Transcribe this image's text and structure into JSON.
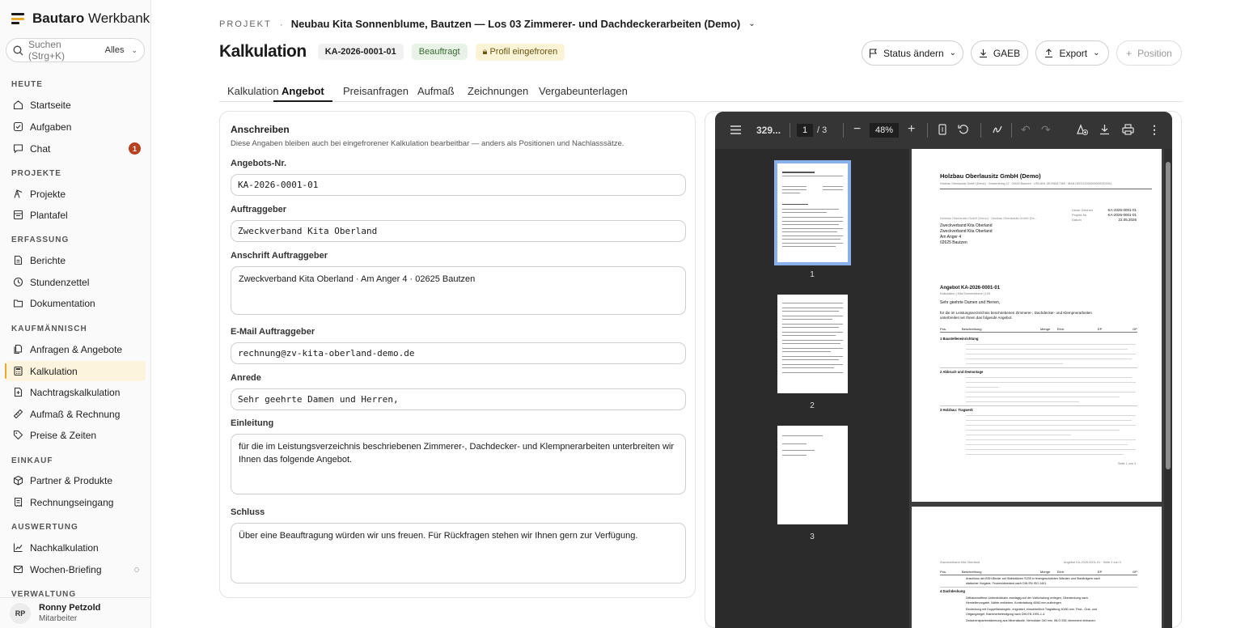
{
  "app": {
    "brand_bold": "Bautaro",
    "brand_light": " Werkbank"
  },
  "search": {
    "placeholder": "Suchen (Strg+K)",
    "scope": "Alles"
  },
  "sidebar": {
    "sections": [
      {
        "title": "HEUTE",
        "items": [
          {
            "label": "Startseite",
            "icon": "home-icon"
          },
          {
            "label": "Aufgaben",
            "icon": "checkbox-icon"
          },
          {
            "label": "Chat",
            "icon": "chat-icon",
            "badge": "1"
          }
        ]
      },
      {
        "title": "PROJEKTE",
        "items": [
          {
            "label": "Projekte",
            "icon": "crane-icon"
          },
          {
            "label": "Plantafel",
            "icon": "board-icon"
          }
        ]
      },
      {
        "title": "ERFASSUNG",
        "items": [
          {
            "label": "Berichte",
            "icon": "file-icon"
          },
          {
            "label": "Stundenzettel",
            "icon": "clock-icon"
          },
          {
            "label": "Dokumentation",
            "icon": "folder-icon"
          }
        ]
      },
      {
        "title": "KAUFMÄNNISCH",
        "items": [
          {
            "label": "Anfragen & Angebote",
            "icon": "file-copy-icon"
          },
          {
            "label": "Kalkulation",
            "icon": "calculator-icon",
            "active": true
          },
          {
            "label": "Nachtragskalkulation",
            "icon": "file-plus-icon"
          },
          {
            "label": "Aufmaß & Rechnung",
            "icon": "ruler-icon"
          },
          {
            "label": "Preise & Zeiten",
            "icon": "tag-icon"
          }
        ]
      },
      {
        "title": "EINKAUF",
        "items": [
          {
            "label": "Partner & Produkte",
            "icon": "box-icon"
          },
          {
            "label": "Rechnungseingang",
            "icon": "receipt-icon"
          }
        ]
      },
      {
        "title": "AUSWERTUNG",
        "items": [
          {
            "label": "Nachkalkulation",
            "icon": "chart-icon"
          },
          {
            "label": "Wochen-Briefing",
            "icon": "mail-icon"
          }
        ]
      },
      {
        "title": "VERWALTUNG",
        "items": []
      }
    ]
  },
  "user": {
    "initials": "RP",
    "name": "Ronny Petzold",
    "role": "Mitarbeiter"
  },
  "header": {
    "crumb_label": "PROJEKT",
    "crumb_sep": "·",
    "project": "Neubau Kita Sonnenblume, Bautzen — Los 03 Zimmerer- und Dachdeckerarbeiten (Demo)",
    "title": "Kalkulation",
    "id_badge": "KA-2026-0001-01",
    "status_badge": "Beauftragt",
    "profile_badge": "Profil eingefroren",
    "buttons": {
      "status": "Status ändern",
      "gaeb": "GAEB",
      "export": "Export",
      "position": "Position"
    }
  },
  "tabs": [
    "Kalkulation",
    "Angebot",
    "Preisanfragen",
    "Aufmaß",
    "Zeichnungen",
    "Vergabeunterlagen"
  ],
  "form": {
    "title": "Anschreiben",
    "subtitle": "Diese Angaben bleiben auch bei eingefrorener Kalkulation bearbeitbar — anders als Positionen und Nachlasssätze.",
    "angebot_nr": {
      "label": "Angebots-Nr.",
      "value": "KA-2026-0001-01"
    },
    "auftraggeber": {
      "label": "Auftraggeber",
      "value": "Zweckverband Kita Oberland"
    },
    "anschrift": {
      "label": "Anschrift Auftraggeber",
      "value": "Zweckverband Kita Oberland · Am Anger 4 · 02625 Bautzen"
    },
    "email": {
      "label": "E-Mail Auftraggeber",
      "value": "rechnung@zv-kita-oberland-demo.de"
    },
    "anrede": {
      "label": "Anrede",
      "value": "Sehr geehrte Damen und Herren,"
    },
    "einleitung": {
      "label": "Einleitung",
      "value": "für die im Leistungsverzeichnis beschriebenen Zimmerer-, Dachdecker- und Klempnerarbeiten unterbreiten wir Ihnen das folgende Angebot."
    },
    "schluss": {
      "label": "Schluss",
      "value": "Über eine Beauftragung würden wir uns freuen. Für Rückfragen stehen wir Ihnen gern zur Verfügung."
    }
  },
  "pdf": {
    "file_short": "329...",
    "page": "1",
    "page_total": "/ 3",
    "zoom": "48%",
    "thumbs": [
      "1",
      "2",
      "3"
    ],
    "page1": {
      "company": "Holzbau Oberlausitz GmbH (Demo)",
      "company_line": "Holzbau Oberlausitz GmbH (Demo) · Gewerbering 12 · 02625 Bautzen · USt-IdNr. DE298417365 · IBAN DE02120300000000202051",
      "sender_small": "Holzbau Oberlausitz GmbH (Demo) · Holzbau Oberlausitz GmbH (De...",
      "recipient": [
        "Zweckverband Kita Oberland",
        "Zweckverband Kita Oberland",
        "Am Anger 4",
        "02625 Bautzen"
      ],
      "meta_labels": [
        "Unser Zeichen",
        "Projekt-Nr.",
        "Datum"
      ],
      "meta_values": [
        "KA-2026-0001-01",
        "KA-2026-0001-01",
        "22.05.2026"
      ],
      "offer_title": "Angebot KA-2026-0001-01",
      "offer_sub": "Kalkulation | Kita Sonnenblume | L03",
      "greeting": "Sehr geehrte Damen und Herren,",
      "intro1": "für die im Leistungsverzeichnis beschriebenen Zimmerer-, Dachdecker- und Klempnerarbeiten",
      "intro2": "unterbreiten wir Ihnen das folgende Angebot.",
      "cols": [
        "Pos.",
        "Beschreibung",
        "Menge",
        "Einh.",
        "EP",
        "GP"
      ],
      "groups": [
        "1 Baustelleneinrichtung",
        "2 Abbruch und Demontage",
        "3 Holzbau: Tragwerk"
      ],
      "footer": "Seite 1 von 3"
    },
    "page2": {
      "header_left": "Zweckverband Kita Oberland",
      "header_right": "Angebot KA-2026-0001-01 · Seite 2 von 3",
      "cols": [
        "Pos.",
        "Beschreibung",
        "Menge",
        "Einh.",
        "EP",
        "GP"
      ],
      "line1": "Anschluss der BSH-Binder auf Stahlstützen S235 in feuergeschützten Wänden und Stahlträgern nach",
      "line2": "statischer Vorgabe. Feuerwiderstand nach DIN EN ISO 1401.",
      "group": "4 Dachdeckung",
      "l3": "Diffusionsoffene Unterdeckbahn zweilagig auf der Vollschalung verlegen, Überdeckung nach",
      "l4": "Herstellervorgabe, Nähte verkleben. Konterlattung 40/60 mm aufbringen.",
      "l5": "Eindeckung mit Doppelfalzziegeln, engobiert, einschließlich Traglattung 40/60 mm. First-, Grat- und",
      "l6": "Ortgangziegel; Klammerbefestigung nach DIN EN 1991-1-4.",
      "l7": "Zwischensparrendämmung aus Mineralwolle, Nenndicke 240 mm, WLG 035, klemmend einbauen."
    }
  }
}
